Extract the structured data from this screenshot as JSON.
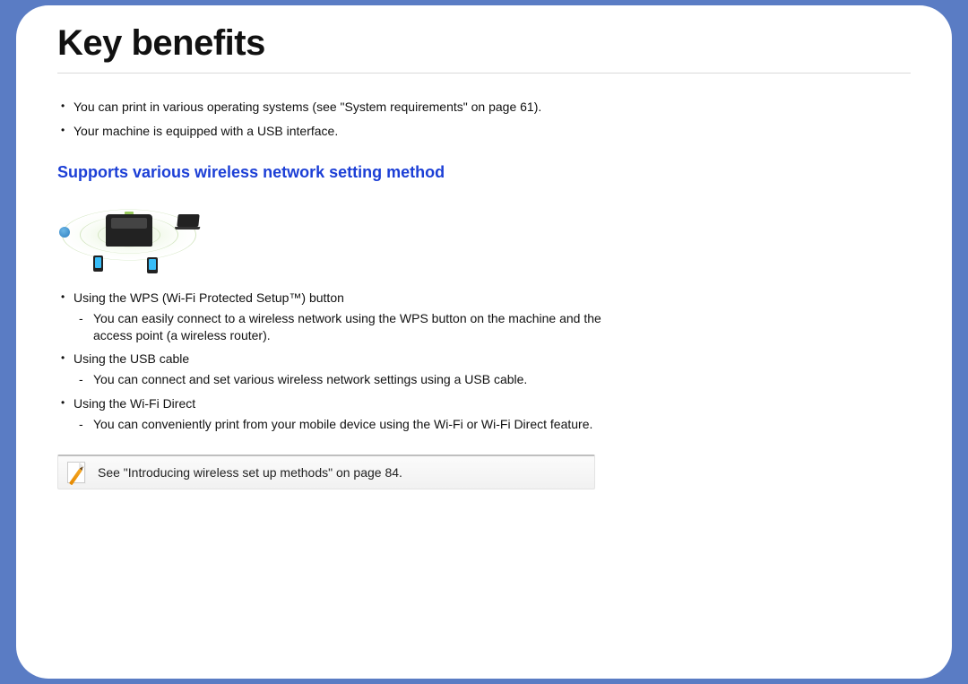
{
  "title": "Key benefits",
  "intro_bullets": [
    "You can print in various operating systems (see \"System requirements\" on page 61).",
    "Your machine is equipped with a USB interface."
  ],
  "section_heading": "Supports various wireless network setting method",
  "methods": [
    {
      "label": "Using the WPS (Wi-Fi Protected Setup™) button",
      "details": [
        "You can easily connect to a wireless network using the WPS button on the machine and the access point (a wireless router)."
      ]
    },
    {
      "label": "Using the USB cable",
      "details": [
        "You can connect and set various wireless network settings using a USB cable."
      ]
    },
    {
      "label": "Using the Wi-Fi Direct",
      "details": [
        "You can conveniently print from your mobile device using the Wi-Fi or Wi-Fi Direct feature."
      ]
    }
  ],
  "note": "See \"Introducing wireless set up methods\" on page 84."
}
